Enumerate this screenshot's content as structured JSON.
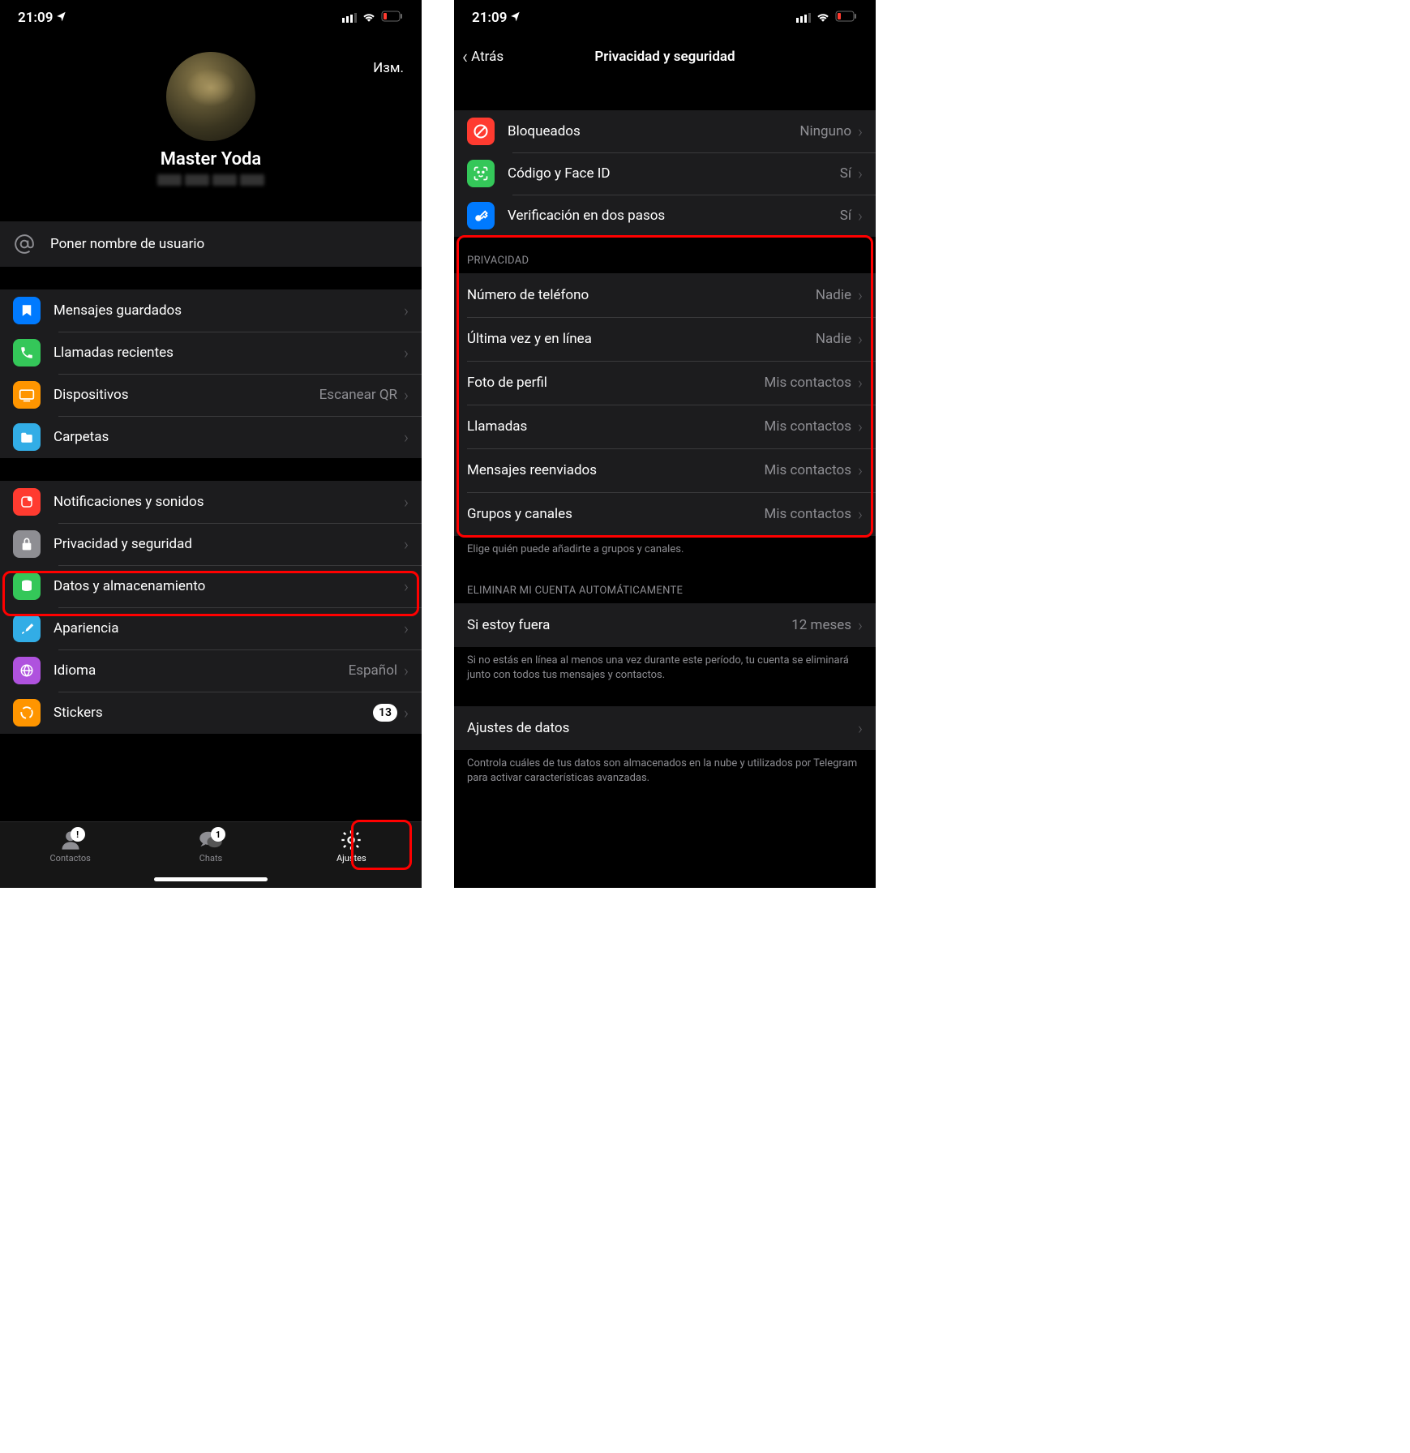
{
  "status": {
    "time": "21:09",
    "time2": "21:09"
  },
  "left": {
    "edit": "Изм.",
    "profile_name": "Master Yoda",
    "username_row": "Poner nombre de usuario",
    "rows_g1": {
      "saved": "Mensajes guardados",
      "calls": "Llamadas recientes",
      "devices": "Dispositivos",
      "devices_val": "Escanear QR",
      "folders": "Carpetas"
    },
    "rows_g2": {
      "notif": "Notificaciones y sonidos",
      "privacy": "Privacidad y seguridad",
      "data": "Datos y almacenamiento",
      "appearance": "Apariencia",
      "lang": "Idioma",
      "lang_val": "Español",
      "stickers": "Stickers",
      "stickers_badge": "13"
    },
    "tabs": {
      "contacts": "Contactos",
      "contacts_badge": "!",
      "chats": "Chats",
      "chats_badge": "1",
      "settings": "Ajustes"
    }
  },
  "right": {
    "back": "Atrás",
    "title": "Privacidad y seguridad",
    "sec1": {
      "blocked": "Bloqueados",
      "blocked_val": "Ninguno",
      "code": "Código y Face ID",
      "code_val": "Sí",
      "twostep": "Verificación en dos pasos",
      "twostep_val": "Sí"
    },
    "privacy_header": "PRIVACIDAD",
    "privacy": {
      "phone": "Número de teléfono",
      "phone_val": "Nadie",
      "lastseen": "Última vez y en línea",
      "lastseen_val": "Nadie",
      "photo": "Foto de perfil",
      "photo_val": "Mis contactos",
      "calls": "Llamadas",
      "calls_val": "Mis contactos",
      "fwd": "Mensajes reenviados",
      "fwd_val": "Mis contactos",
      "groups": "Grupos y canales",
      "groups_val": "Mis contactos"
    },
    "privacy_footer": "Elige quién puede añadirte a grupos y canales.",
    "delete_header": "ELIMINAR MI CUENTA AUTOMÁTICAMENTE",
    "delete": {
      "away": "Si estoy fuera",
      "away_val": "12 meses"
    },
    "delete_footer": "Si no estás en línea al menos una vez durante este período, tu cuenta se eliminará junto con todos tus mensajes y contactos.",
    "data_settings": "Ajustes de datos",
    "data_footer": "Controla cuáles de tus datos son almacenados en la nube y utilizados por Telegram para activar características avanzadas."
  },
  "colors": {
    "blue": "#007aff",
    "green": "#34c759",
    "orange": "#ff9500",
    "red": "#ff3b30",
    "cyan": "#32ade6",
    "gray": "#8e8e93",
    "purple": "#af52de",
    "key_blue": "#2481cc"
  }
}
